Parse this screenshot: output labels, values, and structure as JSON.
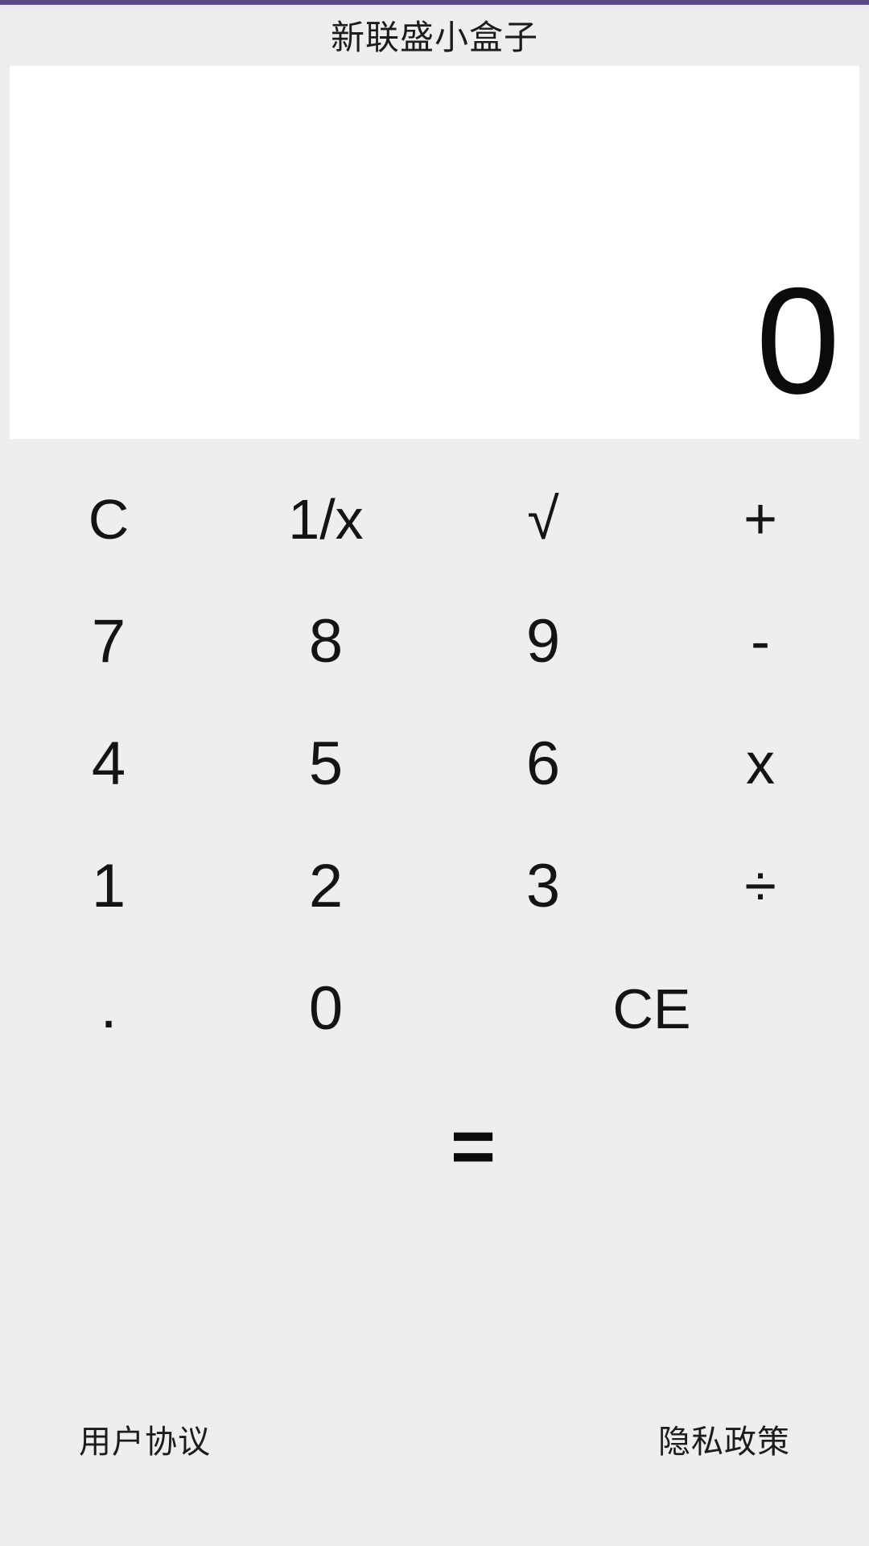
{
  "app": {
    "title": "新联盛小盒子",
    "accent_color": "#57488a",
    "accent_under_color": "#e9e6f0",
    "background_color": "#efeeee",
    "display_background_color": "#ffffff",
    "text_color": "#141414"
  },
  "display": {
    "value": "0",
    "align": "right"
  },
  "keypad": {
    "rows": [
      {
        "keys": [
          {
            "label": "C",
            "name": "key-clear"
          },
          {
            "label": "1/x",
            "name": "key-reciprocal"
          },
          {
            "label": "√",
            "name": "key-sqrt"
          },
          {
            "label": "+",
            "name": "key-add"
          }
        ]
      },
      {
        "keys": [
          {
            "label": "7",
            "name": "key-7"
          },
          {
            "label": "8",
            "name": "key-8"
          },
          {
            "label": "9",
            "name": "key-9"
          },
          {
            "label": "-",
            "name": "key-subtract"
          }
        ]
      },
      {
        "keys": [
          {
            "label": "4",
            "name": "key-4"
          },
          {
            "label": "5",
            "name": "key-5"
          },
          {
            "label": "6",
            "name": "key-6"
          },
          {
            "label": "x",
            "name": "key-multiply"
          }
        ]
      },
      {
        "keys": [
          {
            "label": "1",
            "name": "key-1"
          },
          {
            "label": "2",
            "name": "key-2"
          },
          {
            "label": "3",
            "name": "key-3"
          },
          {
            "label": "÷",
            "name": "key-divide"
          }
        ]
      },
      {
        "keys": [
          {
            "label": ".",
            "name": "key-decimal-point"
          },
          {
            "label": "0",
            "name": "key-0"
          },
          {
            "label": "CE",
            "name": "key-clear-entry"
          }
        ]
      }
    ],
    "equals": {
      "label": "=",
      "name": "key-equals"
    }
  },
  "footer": {
    "user_agreement": "用户协议",
    "privacy_policy": "隐私政策"
  }
}
